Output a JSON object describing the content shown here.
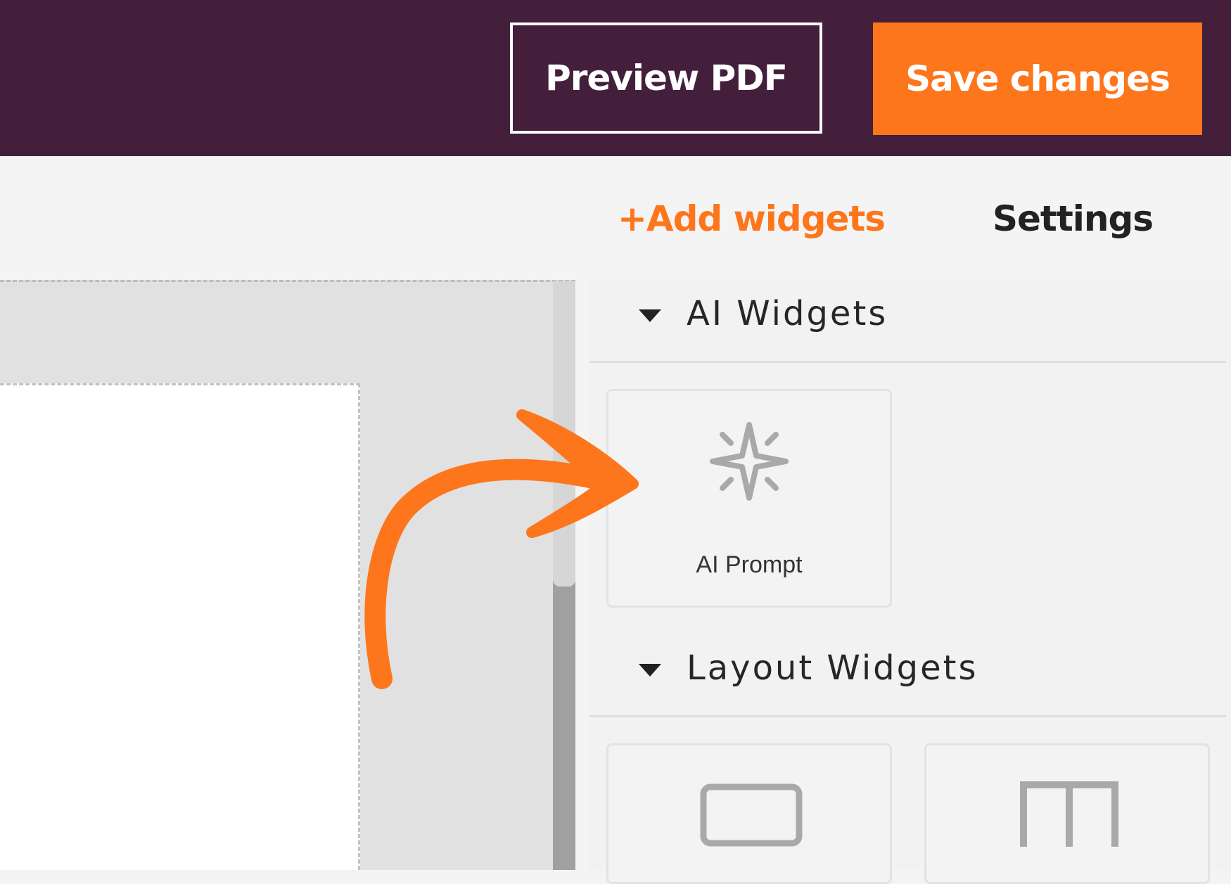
{
  "header": {
    "preview_label": "Preview PDF",
    "save_label": "Save changes"
  },
  "tabs": {
    "add_widgets": "+Add widgets",
    "settings": "Settings"
  },
  "panel": {
    "sections": [
      {
        "title": "AI Widgets",
        "widgets": [
          {
            "label": "AI Prompt",
            "icon": "sparkle-icon"
          }
        ]
      },
      {
        "title": "Layout Widgets",
        "widgets": [
          {
            "label": "",
            "icon": "single-column-icon"
          },
          {
            "label": "",
            "icon": "two-column-icon"
          }
        ]
      }
    ]
  },
  "colors": {
    "header_bg": "#431f3c",
    "accent": "#fd761b",
    "panel_bg": "#f2f2f2"
  }
}
